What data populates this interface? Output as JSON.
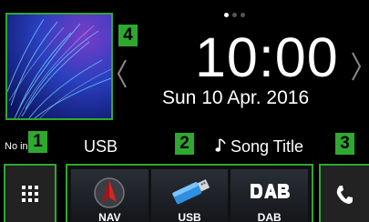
{
  "callouts": {
    "art": "4",
    "menu": "1",
    "shortcuts": "2",
    "phone": "3"
  },
  "clock": {
    "time": "10:00",
    "date": "Sun 10 Apr. 2016"
  },
  "pagination": {
    "active": 0,
    "count": 3
  },
  "now_playing": {
    "label": "No ing",
    "source": "USB",
    "title": "Song Title",
    "note_icon": "music-note-icon"
  },
  "shortcuts": [
    {
      "label": "NAV",
      "icon": "navigation-icon"
    },
    {
      "label": "USB",
      "icon": "usb-drive-icon"
    },
    {
      "label": "DAB",
      "icon": "dab-icon"
    }
  ],
  "menu_button": {
    "icon": "grid-menu-icon"
  },
  "phone_button": {
    "icon": "phone-icon"
  },
  "colors": {
    "accent": "#2fa82f",
    "background": "#000000"
  }
}
